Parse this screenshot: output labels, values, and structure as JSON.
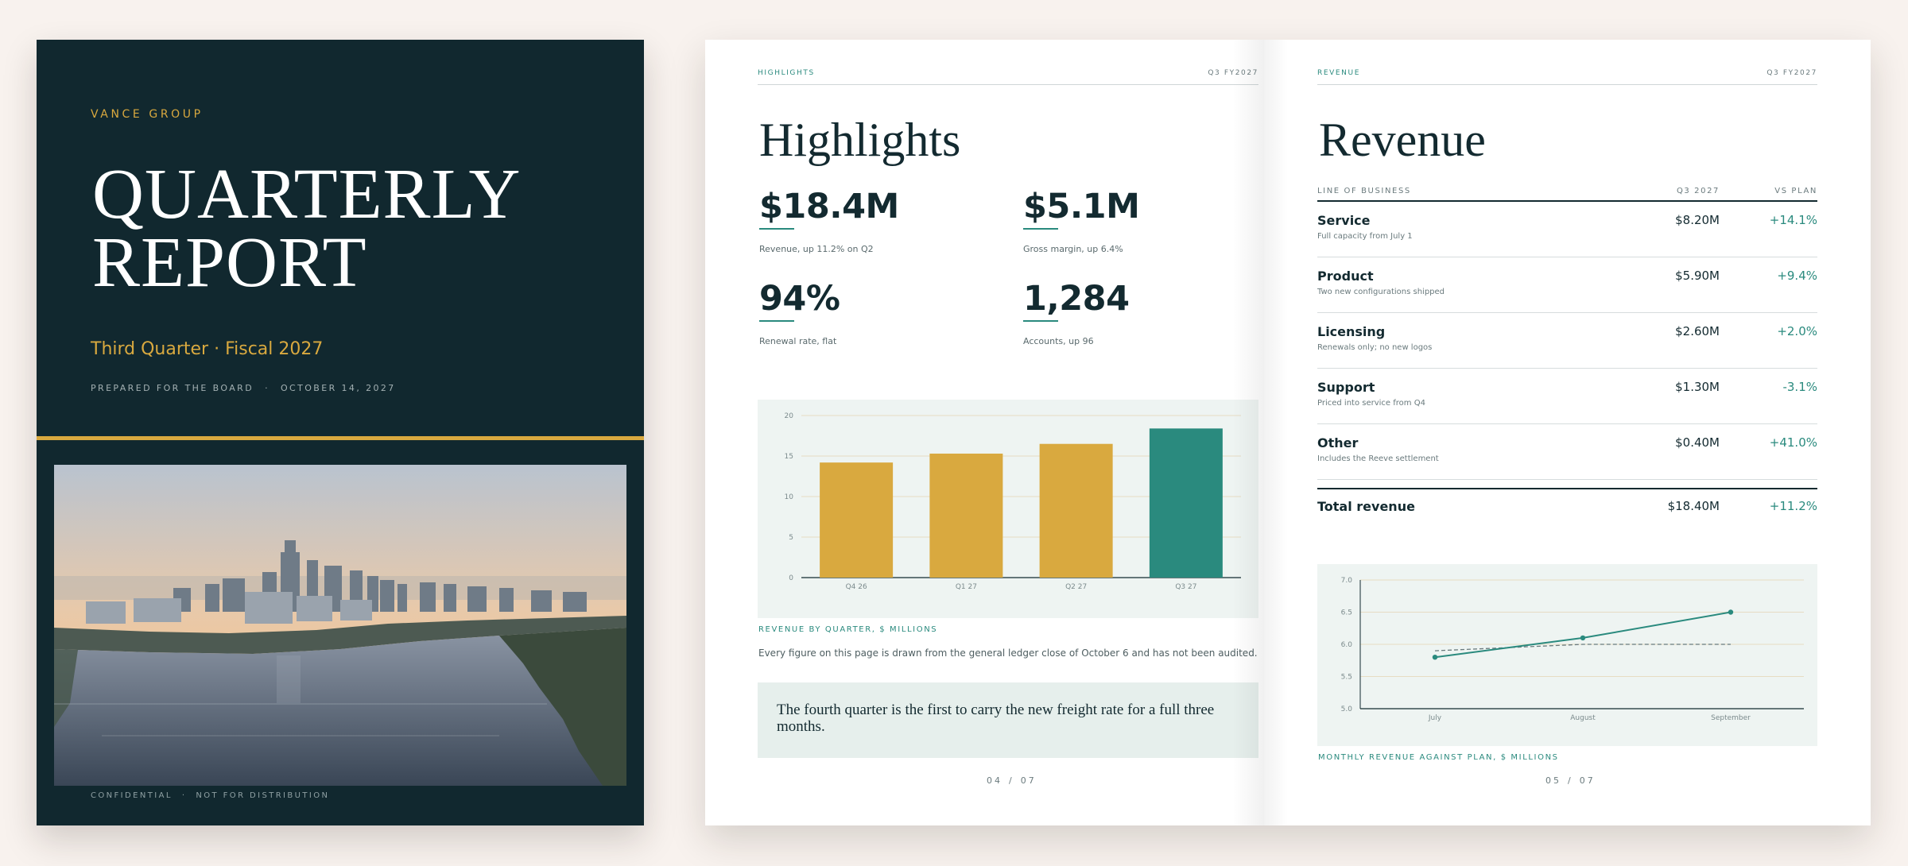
{
  "cover": {
    "brand": "VANCE GROUP",
    "title_line1": "QUARTERLY",
    "title_line2": "REPORT",
    "subtitle": "Third Quarter · Fiscal 2027",
    "prepared_for": "PREPARED FOR THE BOARD",
    "separator": "·",
    "date": "OCTOBER 14, 2027",
    "footer_left": "CONFIDENTIAL",
    "footer_right": "NOT FOR DISTRIBUTION",
    "photo_icon": "city-skyline-river-photo"
  },
  "highlights": {
    "section": "HIGHLIGHTS",
    "period": "Q3 FY2027",
    "title": "Highlights",
    "kpis": [
      {
        "value": "$18.4M",
        "caption": "Revenue, up 11.2% on Q2"
      },
      {
        "value": "$5.1M",
        "caption": "Gross margin, up 6.4%"
      },
      {
        "value": "94%",
        "caption": "Renewal rate, flat"
      },
      {
        "value": "1,284",
        "caption": "Accounts, up 96"
      }
    ],
    "chart_caption": "REVENUE BY QUARTER, $ MILLIONS",
    "note": "Every figure on this page is drawn from the general ledger close of October 6 and has not been audited.",
    "pull_quote": "The fourth quarter is the first to carry the new freight rate for a full three months.",
    "folio_page": "04",
    "folio_sep": "/",
    "folio_total": "07"
  },
  "revenue": {
    "section": "REVENUE",
    "period": "Q3 FY2027",
    "title": "Revenue",
    "headers": {
      "line": "LINE OF BUSINESS",
      "q3": "Q3 2027",
      "vs": "VS PLAN"
    },
    "rows": [
      {
        "name": "Service",
        "sub": "Full capacity from July 1",
        "q3": "$8.20M",
        "vs": "+14.1%"
      },
      {
        "name": "Product",
        "sub": "Two new configurations shipped",
        "q3": "$5.90M",
        "vs": "+9.4%"
      },
      {
        "name": "Licensing",
        "sub": "Renewals only; no new logos",
        "q3": "$2.60M",
        "vs": "+2.0%"
      },
      {
        "name": "Support",
        "sub": "Priced into service from Q4",
        "q3": "$1.30M",
        "vs": "-3.1%"
      },
      {
        "name": "Other",
        "sub": "Includes the Reeve settlement",
        "q3": "$0.40M",
        "vs": "+41.0%"
      }
    ],
    "total": {
      "name": "Total revenue",
      "q3": "$18.40M",
      "vs": "+11.2%"
    },
    "chart_caption": "MONTHLY REVENUE AGAINST PLAN, $ MILLIONS",
    "folio_page": "05",
    "folio_sep": "/",
    "folio_total": "07"
  },
  "colors": {
    "navy": "#11282f",
    "gold": "#d9a93f",
    "teal": "#2a8a7e",
    "panel": "#eef4f2"
  },
  "chart_data": [
    {
      "type": "bar",
      "categories": [
        "Q4 26",
        "Q1 27",
        "Q2 27",
        "Q3 27"
      ],
      "values": [
        14.2,
        15.3,
        16.5,
        18.4
      ],
      "highlight_index": 3,
      "ylim": [
        0,
        20
      ],
      "yticks": [
        0,
        5,
        10,
        15,
        20
      ],
      "grid": true,
      "title": "",
      "xlabel": "",
      "ylabel": ""
    },
    {
      "type": "line",
      "x": [
        "July",
        "August",
        "September"
      ],
      "series": [
        {
          "values": [
            5.8,
            6.1,
            6.5
          ],
          "style": "solid"
        },
        {
          "values": [
            5.9,
            6.0,
            6.0
          ],
          "style": "dashed"
        }
      ],
      "ylim": [
        5.0,
        7.0
      ],
      "yticks": [
        "5.0",
        "5.5",
        "6.0",
        "6.5",
        "7.0"
      ],
      "grid": true,
      "title": "",
      "xlabel": "",
      "ylabel": ""
    }
  ]
}
